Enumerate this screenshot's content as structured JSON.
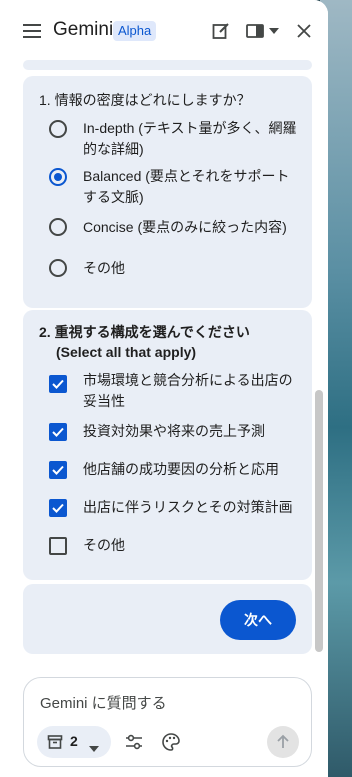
{
  "header": {
    "title": "Gemini",
    "badge": "Alpha"
  },
  "question1": {
    "title": "1. 情報の密度はどれにしますか？",
    "selected_index": 1,
    "options": [
      {
        "label": "In-depth (テキスト量が多く、網羅的な詳細)",
        "selected": false
      },
      {
        "label": "Balanced (要点とそれをサポートする文脈)",
        "selected": true
      },
      {
        "label": "Concise (要点のみに絞った内容)",
        "selected": false
      },
      {
        "label": "その他",
        "selected": false
      }
    ]
  },
  "question2": {
    "title": "2. 重視する構成を選んでください",
    "subtitle": "(Select all that apply)",
    "options": [
      {
        "label": "市場環境と競合分析による出店の妥当性",
        "checked": true
      },
      {
        "label": "投資対効果や将来の売上予測",
        "checked": true
      },
      {
        "label": "他店舗の成功要因の分析と応用",
        "checked": true
      },
      {
        "label": "出店に伴うリスクとその対策計画",
        "checked": true
      },
      {
        "label": "その他",
        "checked": false
      }
    ]
  },
  "next_button": "次へ",
  "input": {
    "placeholder": "Gemini に質問する",
    "chip_count": "2"
  },
  "colors": {
    "accent": "#0b57d0",
    "card_bg": "#e9eef6",
    "badge_bg": "#dfe8fb"
  },
  "icons": [
    "menu-icon",
    "edit-icon",
    "sidebar-toggle-icon",
    "chevron-down-icon",
    "close-icon",
    "archive-icon",
    "tune-icon",
    "palette-icon",
    "arrow-up-icon"
  ]
}
